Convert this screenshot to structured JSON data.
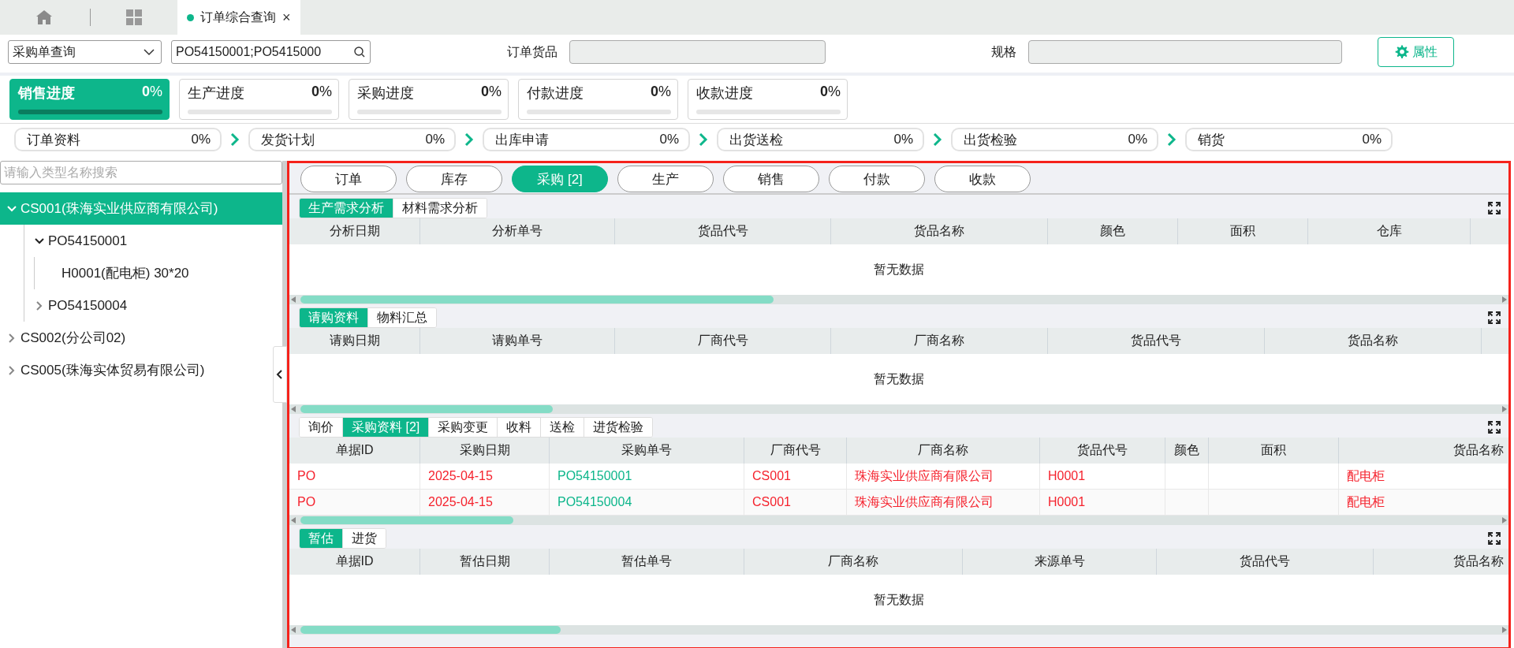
{
  "window_tabs": [
    {
      "label": "订单综合查询",
      "close": "×",
      "selected": true
    }
  ],
  "filter": {
    "query_type": "采购单查询",
    "search_value": "PO54150001;PO5415000",
    "fields": [
      {
        "label": "订单货品"
      },
      {
        "label": "规格"
      }
    ],
    "properties_button": "属性"
  },
  "progress": [
    {
      "label": "销售进度",
      "value": "**0**%",
      "selected": true,
      "level": 0
    },
    {
      "label": "生产进度",
      "value": "**0**%",
      "selected": false,
      "level": 0
    },
    {
      "label": "采购进度",
      "value": "**0**%",
      "selected": false,
      "level": 0
    },
    {
      "label": "付款进度",
      "value": "**0**%",
      "selected": false,
      "level": 0
    },
    {
      "label": "收款进度",
      "value": "**0**%",
      "selected": false,
      "level": 0
    }
  ],
  "steps": [
    {
      "label": "订单资料",
      "value": "0%"
    },
    {
      "label": "发货计划",
      "value": "0%"
    },
    {
      "label": "出库申请",
      "value": "0%"
    },
    {
      "label": "出货送检",
      "value": "0%"
    },
    {
      "label": "出货检验",
      "value": "0%"
    },
    {
      "label": "销货",
      "value": "0%"
    }
  ],
  "sidebar": {
    "search_placeholder": "请输入类型名称搜索",
    "tree": [
      {
        "label": "CS001(珠海实业供应商有限公司)",
        "expanded": true,
        "selected": true,
        "children": [
          {
            "label": "PO54150001",
            "expanded": true,
            "selected": false,
            "children": [
              {
                "label": "H0001(配电柜) 30*20",
                "selected": false
              }
            ]
          },
          {
            "label": "PO54150004",
            "expanded": false,
            "selected": false
          }
        ]
      },
      {
        "label": "CS002(分公司02)",
        "expanded": false,
        "selected": false
      },
      {
        "label": "CS005(珠海实体贸易有限公司)",
        "expanded": false,
        "selected": false
      }
    ]
  },
  "module_tabs": [
    {
      "label": "订单",
      "selected": false
    },
    {
      "label": "库存",
      "selected": false
    },
    {
      "label": "采购 [2]",
      "selected": true
    },
    {
      "label": "生产",
      "selected": false
    },
    {
      "label": "销售",
      "selected": false
    },
    {
      "label": "付款",
      "selected": false
    },
    {
      "label": "收款",
      "selected": false
    }
  ],
  "sections": [
    {
      "subtabs": [
        {
          "label": "生产需求分析",
          "selected": true
        },
        {
          "label": "材料需求分析",
          "selected": false
        }
      ],
      "columns": [
        {
          "label": "分析日期"
        },
        {
          "label": "分析单号"
        },
        {
          "label": "货品代号"
        },
        {
          "label": "货品名称"
        },
        {
          "label": "颜色"
        },
        {
          "label": "面积"
        },
        {
          "label": "仓库"
        }
      ],
      "empty_text": "暂无数据"
    },
    {
      "subtabs": [
        {
          "label": "请购资料",
          "selected": true
        },
        {
          "label": "物料汇总",
          "selected": false
        }
      ],
      "columns": [
        {
          "label": "请购日期"
        },
        {
          "label": "请购单号"
        },
        {
          "label": "厂商代号"
        },
        {
          "label": "厂商名称"
        },
        {
          "label": "货品代号"
        },
        {
          "label": "货品名称"
        }
      ],
      "empty_text": "暂无数据"
    },
    {
      "subtabs": [
        {
          "label": "询价",
          "selected": false
        },
        {
          "label": "采购资料 [2]",
          "selected": true
        },
        {
          "label": "采购变更",
          "selected": false
        },
        {
          "label": "收料",
          "selected": false
        },
        {
          "label": "送检",
          "selected": false
        },
        {
          "label": "进货检验",
          "selected": false
        }
      ],
      "columns": [
        {
          "label": "单据ID",
          "kind": "text"
        },
        {
          "label": "采购日期",
          "kind": "text"
        },
        {
          "label": "采购单号",
          "kind": "link"
        },
        {
          "label": "厂商代号",
          "kind": "text"
        },
        {
          "label": "厂商名称",
          "kind": "text"
        },
        {
          "label": "货品代号",
          "kind": "text"
        },
        {
          "label": "颜色",
          "kind": "text"
        },
        {
          "label": "面积",
          "kind": "text"
        },
        {
          "label": "货品名称",
          "kind": "text"
        }
      ],
      "rows": [
        {
          "cells": [
            "PO",
            "2025-04-15",
            "PO54150001",
            "CS001",
            "珠海实业供应商有限公司",
            "H0001",
            "",
            "",
            "配电柜"
          ]
        },
        {
          "cells": [
            "PO",
            "2025-04-15",
            "PO54150004",
            "CS001",
            "珠海实业供应商有限公司",
            "H0001",
            "",
            "",
            "配电柜"
          ]
        }
      ]
    },
    {
      "subtabs": [
        {
          "label": "暂估",
          "selected": true
        },
        {
          "label": "进货",
          "selected": false
        }
      ],
      "columns": [
        {
          "label": "单据ID"
        },
        {
          "label": "暂估日期"
        },
        {
          "label": "暂估单号"
        },
        {
          "label": "厂商名称"
        },
        {
          "label": "来源单号"
        },
        {
          "label": "货品代号"
        },
        {
          "label": "货品名称"
        }
      ],
      "empty_text": "暂无数据"
    }
  ]
}
